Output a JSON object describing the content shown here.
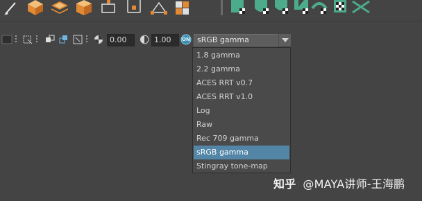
{
  "shelf": {
    "icons": [
      "paint-brush-icon",
      "polygon-cube-icon",
      "polygon-plane-icon",
      "polygon-box-icon",
      "extract-faces-icon",
      "bridge-faces-icon",
      "merge-vertices-icon",
      "split-mesh-icon",
      "uv-face-icon",
      "uv-cylinder-icon",
      "uv-sphere-icon",
      "uv-unfold-icon",
      "uv-relax-icon",
      "uv-checker-icon",
      "uv-cut-icon"
    ]
  },
  "toolbar": {
    "exposure_value": "0.00",
    "gamma_value": "1.00",
    "color_management_badge": "ON"
  },
  "color_space": {
    "selected": "sRGB gamma",
    "options": [
      "1.8 gamma",
      "2.2 gamma",
      "ACES RRT v0.7",
      "ACES RRT v1.0",
      "Log",
      "Raw",
      "Rec 709 gamma",
      "sRGB gamma",
      "Stingray tone-map"
    ],
    "selected_index": 7
  },
  "watermark": {
    "logo": "知乎",
    "text": "@MAYA讲师-王海鹏"
  },
  "colors": {
    "background": "#444444",
    "selection": "#5285a6",
    "accent_orange": "#e08a35",
    "accent_green": "#4cab8a"
  }
}
